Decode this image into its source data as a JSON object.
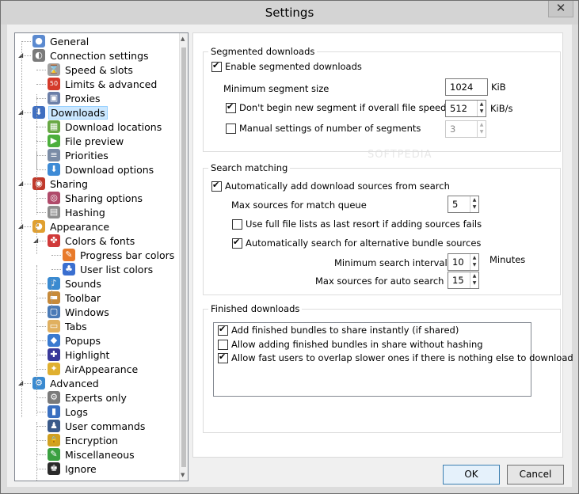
{
  "window": {
    "title": "Settings",
    "close_glyph": "✕"
  },
  "tree": [
    {
      "label": "General",
      "level": 0,
      "expander": "",
      "icon": "user-icon",
      "color": "#5b8ad0",
      "glyph": "●"
    },
    {
      "label": "Connection settings",
      "level": 0,
      "expander": "◢",
      "icon": "connection-icon",
      "color": "#7a7a7a",
      "glyph": "◐"
    },
    {
      "label": "Speed & slots",
      "level": 1,
      "expander": "",
      "icon": "hourglass-icon",
      "color": "#a0a0a0",
      "glyph": "⌛"
    },
    {
      "label": "Limits & advanced",
      "level": 1,
      "expander": "",
      "icon": "speed-limit-icon",
      "color": "#d43a2a",
      "glyph": "50"
    },
    {
      "label": "Proxies",
      "level": 1,
      "expander": "",
      "icon": "proxy-icon",
      "color": "#6b7fa8",
      "glyph": "▣"
    },
    {
      "label": "Downloads",
      "level": 0,
      "expander": "◢",
      "icon": "downloads-icon",
      "color": "#3f6fc1",
      "glyph": "⬇",
      "selected": true
    },
    {
      "label": "Download locations",
      "level": 1,
      "expander": "",
      "icon": "folder-icon",
      "color": "#68a845",
      "glyph": "▦"
    },
    {
      "label": "File preview",
      "level": 1,
      "expander": "",
      "icon": "play-icon",
      "color": "#4caf3c",
      "glyph": "▶"
    },
    {
      "label": "Priorities",
      "level": 1,
      "expander": "",
      "icon": "priorities-icon",
      "color": "#7a8ca6",
      "glyph": "≡"
    },
    {
      "label": "Download options",
      "level": 1,
      "expander": "",
      "icon": "download-options-icon",
      "color": "#3e8bd6",
      "glyph": "⬇"
    },
    {
      "label": "Sharing",
      "level": 0,
      "expander": "◢",
      "icon": "sharing-icon",
      "color": "#c0392b",
      "glyph": "◉"
    },
    {
      "label": "Sharing options",
      "level": 1,
      "expander": "",
      "icon": "sharing-options-icon",
      "color": "#b04a6a",
      "glyph": "◎"
    },
    {
      "label": "Hashing",
      "level": 1,
      "expander": "",
      "icon": "hashing-icon",
      "color": "#8e8e8e",
      "glyph": "▤"
    },
    {
      "label": "Appearance",
      "level": 0,
      "expander": "◢",
      "icon": "palette-icon",
      "color": "#e0a030",
      "glyph": "◕"
    },
    {
      "label": "Colors & fonts",
      "level": 1,
      "expander": "◢",
      "icon": "colors-icon",
      "color": "#d03a3a",
      "glyph": "✤"
    },
    {
      "label": "Progress bar colors",
      "level": 2,
      "expander": "",
      "icon": "progress-icon",
      "color": "#e87a2a",
      "glyph": "✎"
    },
    {
      "label": "User list colors",
      "level": 2,
      "expander": "",
      "icon": "user-list-icon",
      "color": "#3a6fd0",
      "glyph": "♣"
    },
    {
      "label": "Sounds",
      "level": 1,
      "expander": "",
      "icon": "speaker-icon",
      "color": "#3a8ad0",
      "glyph": "♪"
    },
    {
      "label": "Toolbar",
      "level": 1,
      "expander": "",
      "icon": "toolbar-icon",
      "color": "#c78a3a",
      "glyph": "▬"
    },
    {
      "label": "Windows",
      "level": 1,
      "expander": "",
      "icon": "windows-icon",
      "color": "#4a7ab6",
      "glyph": "▢"
    },
    {
      "label": "Tabs",
      "level": 1,
      "expander": "",
      "icon": "tabs-icon",
      "color": "#e0b060",
      "glyph": "▭"
    },
    {
      "label": "Popups",
      "level": 1,
      "expander": "",
      "icon": "popups-icon",
      "color": "#3a7ad0",
      "glyph": "◆"
    },
    {
      "label": "Highlight",
      "level": 1,
      "expander": "",
      "icon": "highlight-icon",
      "color": "#3a3a9a",
      "glyph": "✚"
    },
    {
      "label": "AirAppearance",
      "level": 1,
      "expander": "",
      "icon": "air-appearance-icon",
      "color": "#e0b030",
      "glyph": "✦"
    },
    {
      "label": "Advanced",
      "level": 0,
      "expander": "◢",
      "icon": "advanced-icon",
      "color": "#3a8ad0",
      "glyph": "⚙"
    },
    {
      "label": "Experts only",
      "level": 1,
      "expander": "",
      "icon": "experts-icon",
      "color": "#7a7a7a",
      "glyph": "⚙"
    },
    {
      "label": "Logs",
      "level": 1,
      "expander": "",
      "icon": "logs-icon",
      "color": "#3a6fc0",
      "glyph": "▮"
    },
    {
      "label": "User commands",
      "level": 1,
      "expander": "",
      "icon": "user-commands-icon",
      "color": "#3a5a8a",
      "glyph": "♟"
    },
    {
      "label": "Encryption",
      "level": 1,
      "expander": "",
      "icon": "lock-icon",
      "color": "#d0a020",
      "glyph": "🔒"
    },
    {
      "label": "Miscellaneous",
      "level": 1,
      "expander": "",
      "icon": "pencil-icon",
      "color": "#3aa040",
      "glyph": "✎"
    },
    {
      "label": "Ignore",
      "level": 1,
      "expander": "",
      "icon": "ignore-icon",
      "color": "#2a2a2a",
      "glyph": "♚"
    }
  ],
  "segmented": {
    "title": "Segmented downloads",
    "enable_label": "Enable segmented downloads",
    "enable_checked": true,
    "min_size_label": "Minimum segment size",
    "min_size_value": "1024",
    "min_size_unit": "KiB",
    "dont_begin_label": "Don't begin new segment if overall file speed is over",
    "dont_begin_checked": true,
    "speed_value": "512",
    "speed_unit": "KiB/s",
    "manual_label": "Manual settings of number of segments",
    "manual_checked": false,
    "manual_value": "3"
  },
  "search": {
    "title": "Search matching",
    "auto_add_label": "Automatically add download sources from search",
    "auto_add_checked": true,
    "max_queue_label": "Max sources for match queue",
    "max_queue_value": "5",
    "full_lists_label": "Use full file lists as last resort if adding sources fails",
    "full_lists_checked": false,
    "auto_search_label": "Automatically search for alternative bundle sources",
    "auto_search_checked": true,
    "min_interval_label": "Minimum search interval",
    "min_interval_value": "10",
    "min_interval_unit": "Minutes",
    "max_auto_label": "Max sources for auto search",
    "max_auto_value": "15"
  },
  "finished": {
    "title": "Finished downloads",
    "items": [
      {
        "label": "Add finished bundles to share instantly (if shared)",
        "checked": true
      },
      {
        "label": "Allow adding finished bundles in share without hashing",
        "checked": false
      },
      {
        "label": "Allow fast users to overlap slower ones if there is nothing else to download",
        "checked": true
      }
    ]
  },
  "buttons": {
    "ok": "OK",
    "cancel": "Cancel"
  },
  "watermark": "SOFTPEDIA"
}
